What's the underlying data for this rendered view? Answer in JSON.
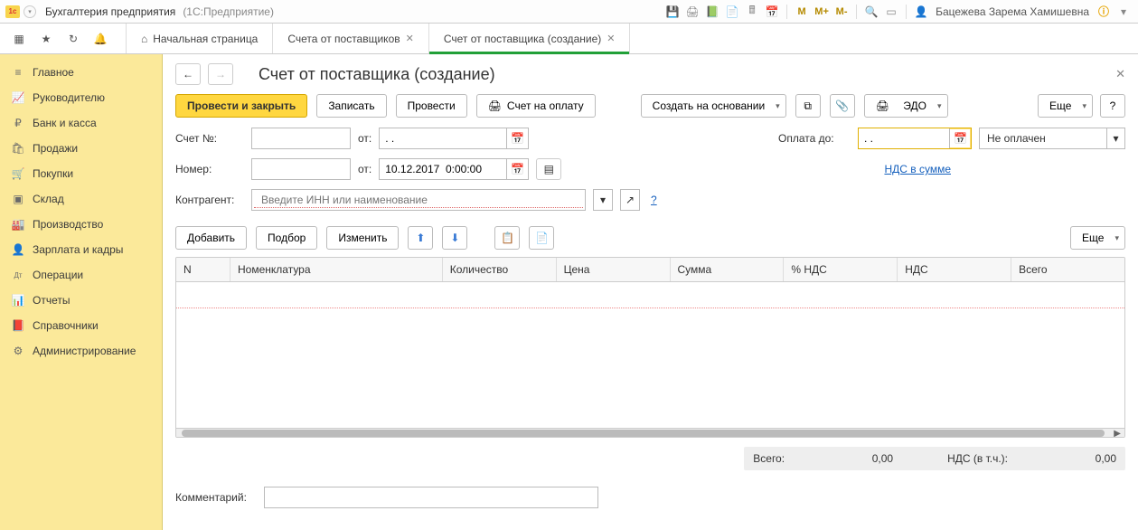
{
  "title_bar": {
    "app_title": "Бухгалтерия предприятия",
    "platform": "(1С:Предприятие)",
    "user": "Бацежева Зарема Хамишевна",
    "zoom_icons": [
      "M",
      "M+",
      "M-"
    ]
  },
  "tabs": {
    "home": "Начальная страница",
    "list": "Счета от поставщиков",
    "current": "Счет от поставщика (создание)"
  },
  "sidebar": {
    "items": [
      {
        "icon": "≡",
        "label": "Главное"
      },
      {
        "icon": "📈",
        "label": "Руководителю"
      },
      {
        "icon": "₽",
        "label": "Банк и касса"
      },
      {
        "icon": "🛍",
        "label": "Продажи"
      },
      {
        "icon": "🛒",
        "label": "Покупки"
      },
      {
        "icon": "▣",
        "label": "Склад"
      },
      {
        "icon": "🏭",
        "label": "Производство"
      },
      {
        "icon": "👤",
        "label": "Зарплата и кадры"
      },
      {
        "icon": "Дт",
        "label": "Операции"
      },
      {
        "icon": "📊",
        "label": "Отчеты"
      },
      {
        "icon": "📕",
        "label": "Справочники"
      },
      {
        "icon": "⚙",
        "label": "Администрирование"
      }
    ]
  },
  "page": {
    "title": "Счет от поставщика (создание)",
    "toolbar": {
      "post_close": "Провести и закрыть",
      "save": "Записать",
      "post": "Провести",
      "invoice": "Счет на оплату",
      "base": "Создать на основании",
      "edo": "ЭДО",
      "more": "Еще",
      "help": "?"
    },
    "fields": {
      "account_no_label": "Счет №:",
      "account_no_value": "",
      "from_label": "от:",
      "from_date_value": ". .",
      "number_label": "Номер:",
      "number_value": "",
      "number_date_value": "10.12.2017  0:00:00",
      "pay_until_label": "Оплата до:",
      "pay_until_value": ". .",
      "status_value": "Не оплачен",
      "nds_link": "НДС в сумме",
      "counterparty_label": "Контрагент:",
      "counterparty_placeholder": "Введите ИНН или наименование",
      "comment_label": "Комментарий:"
    },
    "items_toolbar": {
      "add": "Добавить",
      "pick": "Подбор",
      "edit": "Изменить",
      "more": "Еще"
    },
    "grid": {
      "headers": {
        "n": "N",
        "nom": "Номенклатура",
        "qty": "Количество",
        "price": "Цена",
        "sum": "Сумма",
        "vat": "% НДС",
        "nds": "НДС",
        "tot": "Всего"
      },
      "rows": []
    },
    "totals": {
      "total_label": "Всего:",
      "total_value": "0,00",
      "nds_label": "НДС (в т.ч.):",
      "nds_value": "0,00"
    }
  }
}
